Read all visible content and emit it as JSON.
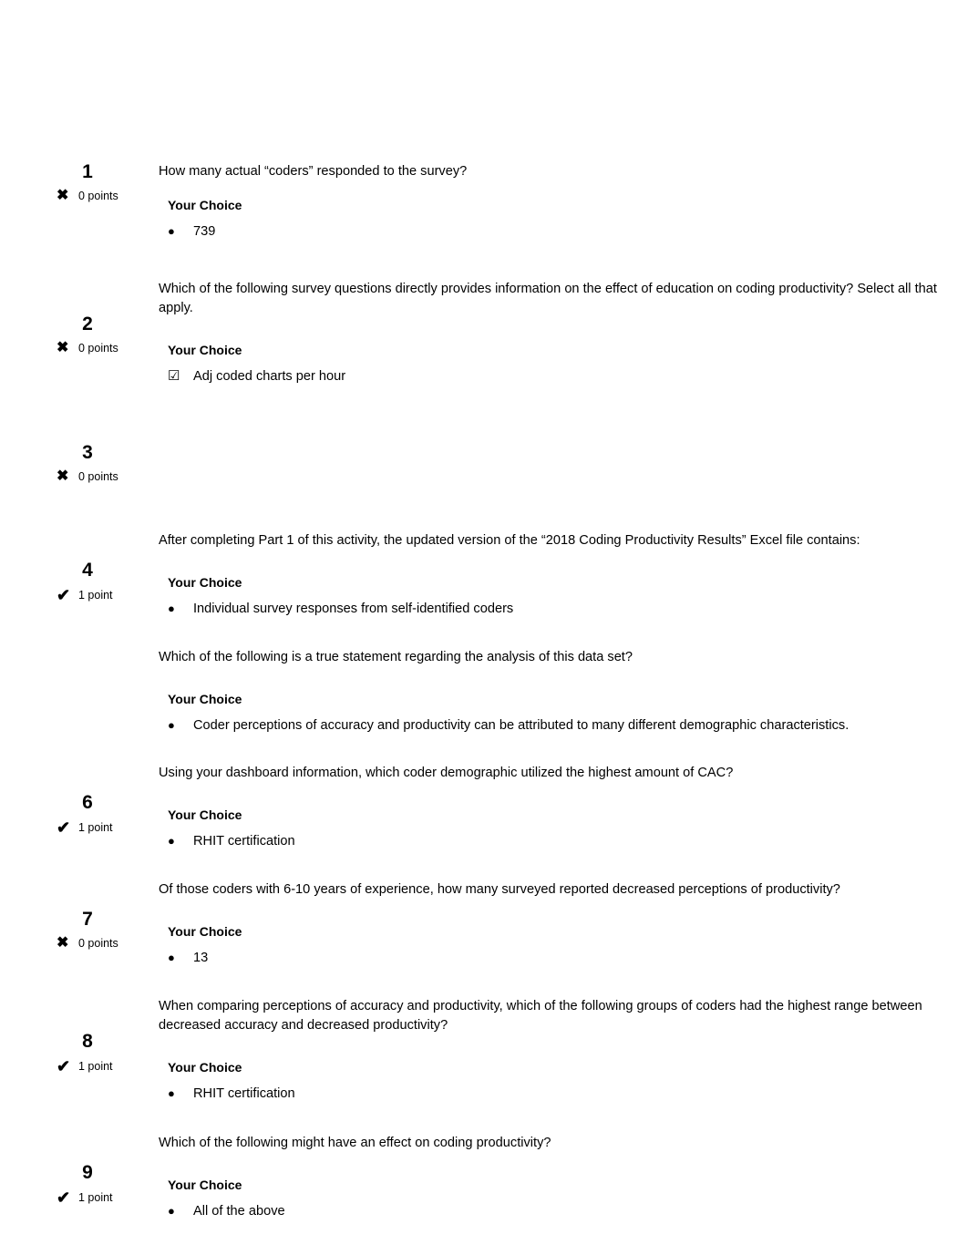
{
  "document": {
    "type": "quiz-results",
    "choice_heading": "Your Choice",
    "marker_radio": "●",
    "marker_checkbox": "☑",
    "icon_correct": "✔",
    "icon_incorrect": "✖"
  },
  "questions": [
    {
      "number": "1",
      "result": "incorrect",
      "result_icon": "✖",
      "points": "0 points",
      "question": "How many actual “coders” responded to the survey?",
      "choice_heading": "Your Choice",
      "choice_type": "radio",
      "choice_marker": "●",
      "choice": "739"
    },
    {
      "number": "2",
      "result": "incorrect",
      "result_icon": "✖",
      "points": "0 points",
      "question": "Which of the following survey questions directly provides information on the effect of education on coding productivity? Select all that apply.",
      "choice_heading": "Your Choice",
      "choice_type": "checkbox",
      "choice_marker": "☑",
      "choice": "Adj coded charts per hour"
    },
    {
      "number": "3",
      "result": "incorrect",
      "result_icon": "✖",
      "points": "0 points",
      "question": "",
      "choice_heading": "",
      "choice_type": "none",
      "choice_marker": "",
      "choice": ""
    },
    {
      "number": "4",
      "result": "correct",
      "result_icon": "✔",
      "points": "1 point",
      "question": "After completing Part 1 of this activity, the updated version of the “2018 Coding Productivity Results” Excel file contains:",
      "choice_heading": "Your Choice",
      "choice_type": "radio",
      "choice_marker": "●",
      "choice": "Individual survey responses from self-identified coders"
    },
    {
      "number": "",
      "result": "none",
      "result_icon": "",
      "points": "",
      "question": "Which of the following is a true statement regarding the analysis of this data set?",
      "choice_heading": "Your Choice",
      "choice_type": "radio",
      "choice_marker": "●",
      "choice": "Coder perceptions of accuracy and productivity can be attributed to many different demographic characteristics."
    },
    {
      "number": "6",
      "result": "correct",
      "result_icon": "✔",
      "points": "1 point",
      "question": "Using your dashboard information, which coder demographic utilized the highest amount of CAC?",
      "choice_heading": "Your Choice",
      "choice_type": "radio",
      "choice_marker": "●",
      "choice": "RHIT certification"
    },
    {
      "number": "7",
      "result": "incorrect",
      "result_icon": "✖",
      "points": "0 points",
      "question": "Of those coders with 6-10 years of experience, how many surveyed reported decreased perceptions of productivity?",
      "choice_heading": "Your Choice",
      "choice_type": "radio",
      "choice_marker": "●",
      "choice": "13"
    },
    {
      "number": "8",
      "result": "correct",
      "result_icon": "✔",
      "points": "1 point",
      "question": "When comparing perceptions of accuracy and productivity, which of the following groups of coders had the highest range between decreased accuracy and decreased productivity?",
      "choice_heading": "Your Choice",
      "choice_type": "radio",
      "choice_marker": "●",
      "choice": "RHIT certification"
    },
    {
      "number": "9",
      "result": "correct",
      "result_icon": "✔",
      "points": "1 point",
      "question": "Which of the following might have an effect on coding productivity?",
      "choice_heading": "Your Choice",
      "choice_type": "radio",
      "choice_marker": "●",
      "choice": "All of the above"
    }
  ]
}
